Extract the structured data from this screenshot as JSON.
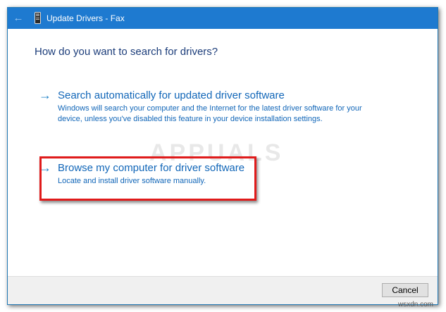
{
  "window": {
    "title": "Update Drivers - Fax",
    "back_icon": "back-arrow-icon",
    "device_icon": "device-icon"
  },
  "dialog": {
    "heading": "How do you want to search for drivers?",
    "options": [
      {
        "title": "Search automatically for updated driver software",
        "description": "Windows will search your computer and the Internet for the latest driver software for your device, unless you've disabled this feature in your device installation settings."
      },
      {
        "title": "Browse my computer for driver software",
        "description": "Locate and install driver software manually."
      }
    ],
    "option_arrow": "→"
  },
  "footer": {
    "cancel_label": "Cancel"
  },
  "watermark": {
    "text": "APPUALS",
    "site": "wsxdn.com"
  },
  "colors": {
    "titlebar": "#1e7ad0",
    "link": "#1166b8",
    "heading": "#1c3d7a",
    "highlight": "#e01b1b"
  }
}
